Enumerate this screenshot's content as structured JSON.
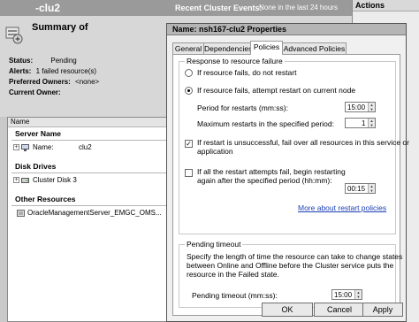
{
  "background": {
    "header_title": "-clu2",
    "recent_events_label": "Recent Cluster Events:",
    "recent_events_value": "None in the last 24 hours",
    "actions_title": "Actions",
    "summary_title": "Summary of",
    "properties": [
      {
        "label": "Status:",
        "value": "Pending"
      },
      {
        "label": "Alerts:",
        "value": "1 failed resource(s)"
      },
      {
        "label": "Preferred Owners:",
        "value": "<none>"
      },
      {
        "label": "Current Owner:",
        "value": ""
      }
    ],
    "list_header": "Name",
    "groups": {
      "server": {
        "title": "Server Name",
        "item_label": "Name:",
        "item_value": "clu2"
      },
      "disk": {
        "title": "Disk Drives",
        "item_label": "Cluster Disk 3"
      },
      "other": {
        "title": "Other Resources",
        "item_label": "OracleManagementServer_EMGC_OMS..."
      }
    }
  },
  "dialog": {
    "title": "Name: nsh167-clu2 Properties",
    "tabs": [
      "General",
      "Dependencies",
      "Policies",
      "Advanced Policies"
    ],
    "active_tab": "Policies",
    "failure_group": {
      "legend": "Response to resource failure",
      "option_no_restart": "If resource fails, do not restart",
      "option_restart": "If resource fails, attempt restart on current node",
      "period_label": "Period for restarts (mm:ss):",
      "period_value": "15:00",
      "max_restarts_label": "Maximum restarts in the specified period:",
      "max_restarts_value": "1",
      "failover_line1": "If restart is unsuccessful, fail over all resources in this service or",
      "failover_line2": "application",
      "failover_checked": true,
      "delay_line1": "If all the restart attempts fail, begin restarting",
      "delay_line2": "again after the specified period (hh:mm):",
      "delay_checked": false,
      "delay_value": "00:15",
      "more_link": "More about restart policies"
    },
    "pending_group": {
      "legend": "Pending timeout",
      "description": [
        "Specify the length of time the resource can take to change states",
        "between Online and Offline before the Cluster service puts the",
        "resource in the Failed state."
      ],
      "timeout_label": "Pending timeout (mm:ss):",
      "timeout_value": "15:00"
    },
    "buttons": {
      "ok": "OK",
      "cancel": "Cancel",
      "apply": "Apply"
    }
  }
}
